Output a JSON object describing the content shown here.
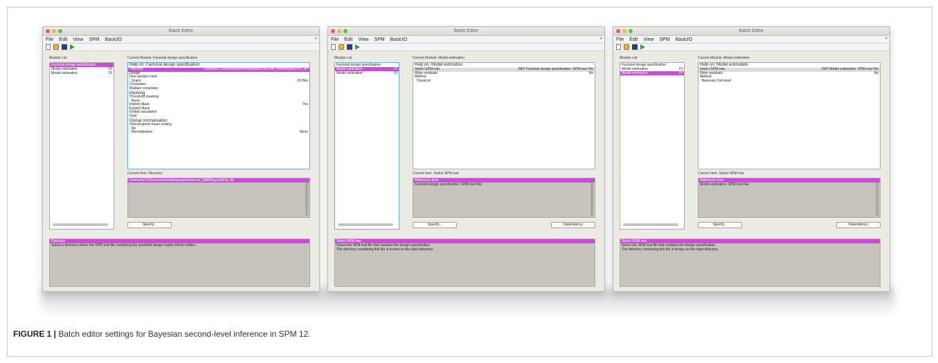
{
  "caption": {
    "label": "FIGURE 1 |",
    "text": " Batch editor settings for Bayesian second-level inference in SPM 12."
  },
  "windows": [
    {
      "title": "Batch Editor",
      "menu": [
        "File",
        "Edit",
        "View",
        "SPM",
        "BasicIO"
      ],
      "module_list_label": "Module List",
      "modules": [
        {
          "label": "Factorial design specification",
          "flag": "",
          "selected": true
        },
        {
          "label": "Model estimation",
          "flag": "DI",
          "selected": false
        },
        {
          "label": "Model estimation",
          "flag": "DI",
          "selected": false
        }
      ],
      "current_module_label": "Current Module: Factorial design specification",
      "module_rows": [
        {
          "label": "Help on: Factorial design specification",
          "value": "",
          "style": "head"
        },
        {
          "label": "Directory",
          "value": "/Users/AUTOR/results/nmrf/bayesian2ndLevel_fMRI/BayesSPM_NI/",
          "style": "sel"
        },
        {
          "label": "Design",
          "value": "",
          "style": ""
        },
        {
          "label": "  One-sample t-test",
          "value": "",
          "style": ""
        },
        {
          "label": "  . Scans",
          "value": "15 files",
          "style": ""
        },
        {
          "label": "Covariates",
          "value": "",
          "style": ""
        },
        {
          "label": "Multiple covariates",
          "value": "",
          "style": ""
        },
        {
          "label": "Masking",
          "value": "",
          "style": "heading-ish"
        },
        {
          "label": "  Threshold masking",
          "value": "",
          "style": ""
        },
        {
          "label": "  . None",
          "value": "",
          "style": ""
        },
        {
          "label": "  Implicit Mask",
          "value": "Yes",
          "style": ""
        },
        {
          "label": "  Explicit Mask",
          "value": "",
          "style": ""
        },
        {
          "label": "Global calculation",
          "value": "",
          "style": ""
        },
        {
          "label": "  Omit",
          "value": "",
          "style": ""
        },
        {
          "label": "Global normalisation",
          "value": "",
          "style": "heading-ish"
        },
        {
          "label": "  Overall grand mean scaling",
          "value": "",
          "style": ""
        },
        {
          "label": "  . No",
          "value": "",
          "style": ""
        },
        {
          "label": "  . Normalisation",
          "value": "None",
          "style": ""
        }
      ],
      "current_item_label": "Current Item: Directory",
      "item_head": "/Users/AUTOR/results/nmrf/bayesian2ndLevel_fMRI/BayesSPM_NI/",
      "item_lines": [],
      "buttons": [
        "Specify..."
      ],
      "help_head": "Directory",
      "help_lines": [
        "Select a directory where the SPM.mat file containing the specified design matrix will be written."
      ]
    },
    {
      "title": "Batch Editor",
      "menu": [
        "File",
        "Edit",
        "View",
        "SPM",
        "BasicIO"
      ],
      "module_list_label": "Module List",
      "modules": [
        {
          "label": "Factorial design specification",
          "flag": "",
          "selected": false
        },
        {
          "label": "Model estimation",
          "flag": "DI",
          "selected": true
        },
        {
          "label": "Model estimation",
          "flag": "DI",
          "selected": false
        }
      ],
      "current_module_label": "Current Module: Model estimation",
      "module_rows": [
        {
          "label": "Help on: Model estimation",
          "value": "",
          "style": "head"
        },
        {
          "label": "Select SPM.mat",
          "value": "DEP Factorial design specification: SPM.mat File",
          "style": "grey"
        },
        {
          "label": "Write residuals",
          "value": "No",
          "style": ""
        },
        {
          "label": "Method",
          "value": "",
          "style": ""
        },
        {
          "label": "  . Classical",
          "value": "",
          "style": ""
        }
      ],
      "current_item_label": "Current Item: Select SPM.mat",
      "item_head": "Reference from",
      "item_lines": [
        "Factorial design specification: SPM.mat File"
      ],
      "buttons": [
        "Specify...",
        "Dependency"
      ],
      "help_head": "Select SPM.mat",
      "help_lines": [
        "Select the SPM.mat file that contains the design specification.",
        "The directory containing this file is known as the input directory."
      ]
    },
    {
      "title": "Batch Editor",
      "menu": [
        "File",
        "Edit",
        "View",
        "SPM",
        "BasicIO"
      ],
      "module_list_label": "Module List",
      "modules": [
        {
          "label": "Factorial design specification",
          "flag": "",
          "selected": false
        },
        {
          "label": "Model estimation",
          "flag": "DI",
          "selected": false
        },
        {
          "label": "Model estimation",
          "flag": "DI",
          "selected": true
        }
      ],
      "current_module_label": "Current Module: Model estimation",
      "module_rows": [
        {
          "label": "Help on: Model estimation",
          "value": "",
          "style": "head"
        },
        {
          "label": "Select SPM.mat",
          "value": "DEP Model estimation: SPM.mat File",
          "style": "grey"
        },
        {
          "label": "Write residuals",
          "value": "No",
          "style": ""
        },
        {
          "label": "Method",
          "value": "",
          "style": ""
        },
        {
          "label": "  . Bayesian 2nd-level",
          "value": "",
          "style": ""
        }
      ],
      "current_item_label": "Current Item: Select SPM.mat",
      "item_head": "Reference from",
      "item_lines": [
        "Model estimation: SPM.mat File"
      ],
      "buttons": [
        "Specify...",
        "Dependency"
      ],
      "help_head": "Select SPM.mat",
      "help_lines": [
        "Select the SPM.mat file that contains the design specification.",
        "The directory containing this file is known as the input directory."
      ]
    }
  ]
}
